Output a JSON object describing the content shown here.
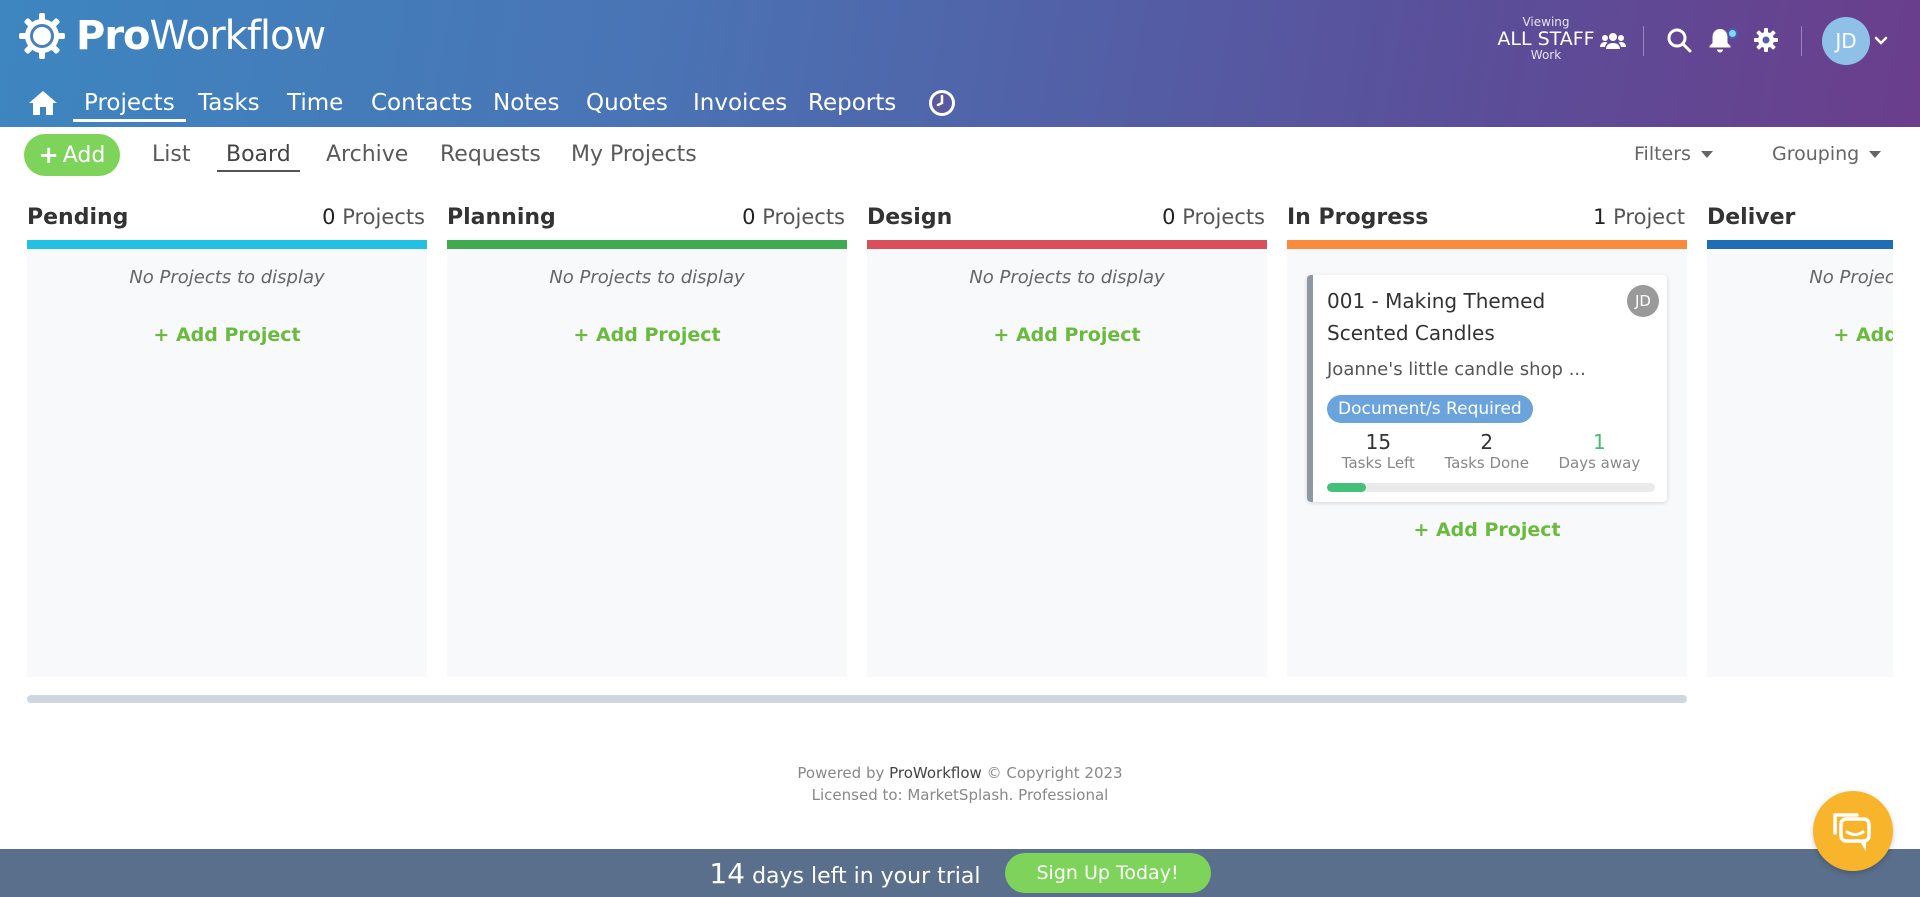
{
  "header": {
    "logo_bold": "Pro",
    "logo_light": "Workflow",
    "viewing_label": "Viewing",
    "viewing_value": "ALL STAFF",
    "viewing_sub": "Work",
    "avatar_initials": "JD"
  },
  "nav": {
    "items": [
      {
        "label": "Projects",
        "active": true
      },
      {
        "label": "Tasks"
      },
      {
        "label": "Time"
      },
      {
        "label": "Contacts"
      },
      {
        "label": "Notes"
      },
      {
        "label": "Quotes"
      },
      {
        "label": "Invoices"
      },
      {
        "label": "Reports"
      }
    ]
  },
  "subnav": {
    "add_label": "Add",
    "tabs": [
      {
        "label": "List"
      },
      {
        "label": "Board",
        "active": true
      },
      {
        "label": "Archive"
      },
      {
        "label": "Requests"
      },
      {
        "label": "My Projects"
      }
    ],
    "filters_label": "Filters",
    "grouping_label": "Grouping"
  },
  "columns": [
    {
      "title": "Pending",
      "count": "0",
      "unit": "Projects",
      "color": "#22c1e3",
      "empty": "No Projects to display",
      "add": "+ Add Project"
    },
    {
      "title": "Planning",
      "count": "0",
      "unit": "Projects",
      "color": "#3faa4f",
      "empty": "No Projects to display",
      "add": "+ Add Project"
    },
    {
      "title": "Design",
      "count": "0",
      "unit": "Projects",
      "color": "#d9505b",
      "empty": "No Projects to display",
      "add": "+ Add Project"
    },
    {
      "title": "In Progress",
      "count": "1",
      "unit": "Project",
      "color": "#fa8a3c",
      "add": "+ Add Project"
    },
    {
      "title": "Deliver",
      "color": "#1f6db5",
      "empty": "No Projects to display",
      "add": "+ Add Project"
    }
  ],
  "card": {
    "title": "001 - Making Themed Scented Candles",
    "avatar": "JD",
    "client": "Joanne's little candle shop ...",
    "tag": "Document/s Required",
    "tasks_left": "15",
    "tasks_left_label": "Tasks Left",
    "tasks_done": "2",
    "tasks_done_label": "Tasks Done",
    "days_away": "1",
    "days_away_label": "Days away",
    "progress": 0.12
  },
  "footer": {
    "powered_prefix": "Powered by ",
    "brand": "ProWorkflow",
    "copyright": " © Copyright 2023",
    "licensed": "Licensed to: MarketSplash. Professional"
  },
  "trial": {
    "days": "14",
    "text": "days left in your trial",
    "signup": "Sign Up Today!"
  },
  "colors": {
    "accent_green": "#7ed35a",
    "trial_bar": "#5a6f8b",
    "chat": "#f8b42b"
  }
}
